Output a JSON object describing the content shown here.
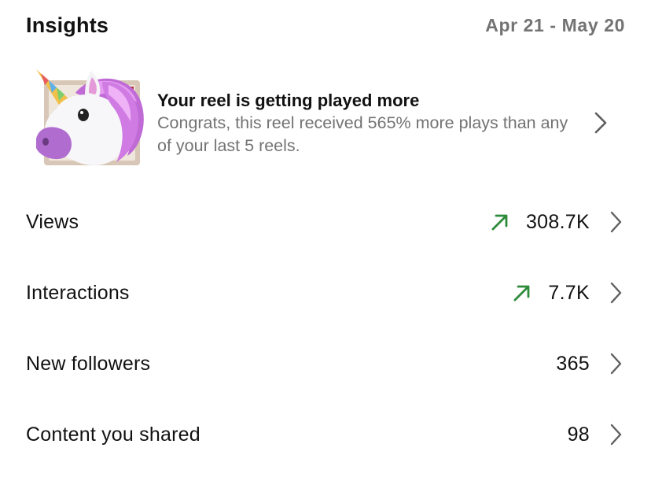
{
  "header": {
    "title": "Insights",
    "date_range": "Apr 21 - May 20"
  },
  "promo": {
    "title": "Your reel is getting played more",
    "body": "Congrats, this reel received 565% more plays than any of your last 5 reels.",
    "art_icon": "unicorn-icon"
  },
  "metrics": [
    {
      "label": "Views",
      "value": "308.7K",
      "trend": "up"
    },
    {
      "label": "Interactions",
      "value": "7.7K",
      "trend": "up"
    },
    {
      "label": "New followers",
      "value": "365",
      "trend": "none"
    },
    {
      "label": "Content you shared",
      "value": "98",
      "trend": "none"
    }
  ],
  "colors": {
    "trend_up": "#2e8b3c",
    "secondary_text": "#737373",
    "chevron": "#5f5f5f"
  }
}
